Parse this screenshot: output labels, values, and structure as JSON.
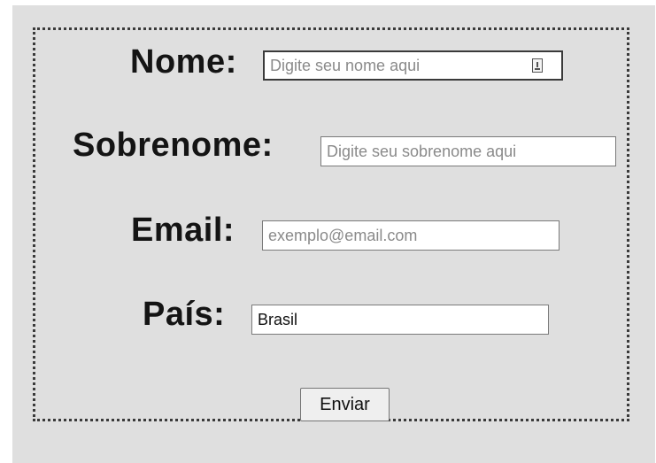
{
  "form": {
    "fields": [
      {
        "label": "Nome:",
        "placeholder": "Digite seu nome aqui",
        "value": ""
      },
      {
        "label": "Sobrenome:",
        "placeholder": "Digite seu sobrenome aqui",
        "value": ""
      },
      {
        "label": "Email:",
        "placeholder": "exemplo@email.com",
        "value": ""
      },
      {
        "label": "País:",
        "placeholder": "",
        "value": "Brasil"
      }
    ],
    "submit_label": "Enviar"
  }
}
